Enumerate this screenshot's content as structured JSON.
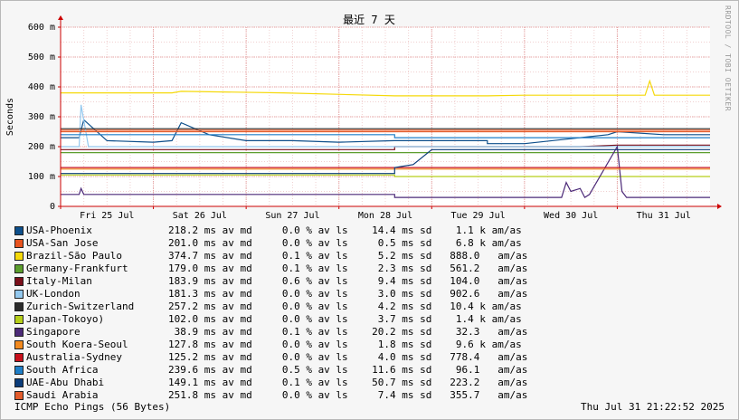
{
  "chart_data": {
    "type": "line",
    "title": "最近 7 天",
    "ylabel": "Seconds",
    "ylim": [
      0,
      0.6
    ],
    "y_ticks": [
      {
        "v": 0,
        "label": "0"
      },
      {
        "v": 0.1,
        "label": "100 m"
      },
      {
        "v": 0.2,
        "label": "200 m"
      },
      {
        "v": 0.3,
        "label": "300 m"
      },
      {
        "v": 0.4,
        "label": "400 m"
      },
      {
        "v": 0.5,
        "label": "500 m"
      },
      {
        "v": 0.6,
        "label": "600 m"
      }
    ],
    "x_range": [
      0,
      7
    ],
    "x_ticks": [
      {
        "v": 0.5,
        "label": "Fri 25 Jul"
      },
      {
        "v": 1.5,
        "label": "Sat 26 Jul"
      },
      {
        "v": 2.5,
        "label": "Sun 27 Jul"
      },
      {
        "v": 3.5,
        "label": "Mon 28 Jul"
      },
      {
        "v": 4.5,
        "label": "Tue 29 Jul"
      },
      {
        "v": 5.5,
        "label": "Wed 30 Jul"
      },
      {
        "v": 6.5,
        "label": "Thu 31 Jul"
      }
    ],
    "grid": true,
    "series": [
      {
        "name": "USA-Phoenix",
        "color": "#0d4f8b",
        "stats": "218.2 ms av md     0.0 % av ls    14.4 ms sd    1.1 k am/as",
        "x": [
          0,
          0.2,
          0.25,
          0.5,
          1.0,
          1.2,
          1.3,
          1.6,
          2.0,
          2.5,
          3.0,
          3.6,
          4.0,
          4.6,
          4.6,
          5.0,
          5.9,
          6.0,
          6.5,
          7.0
        ],
        "y": [
          0.23,
          0.23,
          0.29,
          0.22,
          0.215,
          0.22,
          0.28,
          0.24,
          0.22,
          0.22,
          0.215,
          0.22,
          0.22,
          0.22,
          0.21,
          0.21,
          0.24,
          0.25,
          0.24,
          0.24
        ]
      },
      {
        "name": "USA-San Jose",
        "color": "#e8541f",
        "stats": "201.0 ms av md     0.0 % av ls     0.5 ms sd    6.8 k am/as",
        "x": [
          0,
          7
        ],
        "y": [
          0.255,
          0.255
        ]
      },
      {
        "name": "Brazil-São Paulo",
        "color": "#f5d90a",
        "stats": "374.7 ms av md     0.1 % av ls     5.2 ms sd   888.0   am/as",
        "x": [
          0,
          1.2,
          1.3,
          2.4,
          3.6,
          4.6,
          5.0,
          6.3,
          6.35,
          6.4,
          7.0
        ],
        "y": [
          0.38,
          0.38,
          0.385,
          0.38,
          0.37,
          0.37,
          0.372,
          0.372,
          0.42,
          0.372,
          0.372
        ]
      },
      {
        "name": "Germany-Frankfurt",
        "color": "#5c9e2e",
        "stats": "179.0 ms av md     0.1 % av ls     2.3 ms sd   561.2   am/as",
        "x": [
          0,
          7
        ],
        "y": [
          0.18,
          0.18
        ]
      },
      {
        "name": "Italy-Milan",
        "color": "#7a0f1a",
        "stats": "183.9 ms av md     0.6 % av ls     9.4 ms sd   104.0   am/as",
        "x": [
          0,
          1.6,
          3.6,
          3.6,
          5.6,
          6.0,
          7.0
        ],
        "y": [
          0.19,
          0.19,
          0.19,
          0.2,
          0.2,
          0.205,
          0.205
        ]
      },
      {
        "name": "UK-London",
        "color": "#93c8ee",
        "stats": "181.3 ms av md     0.0 % av ls     3.0 ms sd   902.6   am/as",
        "x": [
          0,
          0.2,
          0.22,
          0.3,
          1.0,
          2.0,
          3.0,
          4.0,
          5.0,
          6.0,
          7.0
        ],
        "y": [
          0.2,
          0.2,
          0.34,
          0.2,
          0.2,
          0.2,
          0.2,
          0.2,
          0.2,
          0.2,
          0.2
        ]
      },
      {
        "name": "Zurich-Switzerland",
        "color": "#2b2b2b",
        "stats": "257.2 ms av md     0.0 % av ls     4.2 ms sd   10.4 k am/as",
        "x": [
          0,
          7
        ],
        "y": [
          0.26,
          0.26
        ]
      },
      {
        "name": "Japan-Tokoyo)",
        "color": "#b6cf1a",
        "stats": "102.0 ms av md     0.0 % av ls     3.7 ms sd    1.4 k am/as",
        "x": [
          0,
          3.6,
          3.6,
          7.0
        ],
        "y": [
          0.105,
          0.105,
          0.1,
          0.1
        ]
      },
      {
        "name": "Singapore",
        "color": "#4c2a78",
        "stats": " 38.9 ms av md     0.1 % av ls    20.2 ms sd    32.3   am/as",
        "x": [
          0,
          0.2,
          0.22,
          0.25,
          3.6,
          3.6,
          5.4,
          5.45,
          5.5,
          5.6,
          5.65,
          5.7,
          6.0,
          6.05,
          6.1,
          7.0
        ],
        "y": [
          0.04,
          0.04,
          0.06,
          0.04,
          0.04,
          0.03,
          0.03,
          0.08,
          0.05,
          0.06,
          0.03,
          0.04,
          0.2,
          0.05,
          0.03,
          0.03
        ]
      },
      {
        "name": "South Koera-Seoul",
        "color": "#f2891e",
        "stats": "127.8 ms av md     0.0 % av ls     1.8 ms sd    9.6 k am/as",
        "x": [
          0,
          7
        ],
        "y": [
          0.125,
          0.125
        ]
      },
      {
        "name": "Australia-Sydney",
        "color": "#c8101c",
        "stats": "125.2 ms av md     0.0 % av ls     4.0 ms sd   778.4   am/as",
        "x": [
          0,
          7
        ],
        "y": [
          0.13,
          0.13
        ]
      },
      {
        "name": "South Africa",
        "color": "#1f7fc8",
        "stats": "239.6 ms av md     0.5 % av ls    11.6 ms sd    96.1   am/as",
        "x": [
          0,
          3.6,
          3.6,
          4.7,
          7.0
        ],
        "y": [
          0.24,
          0.24,
          0.23,
          0.23,
          0.23
        ]
      },
      {
        "name": "UAE-Abu Dhabi",
        "color": "#0b3c7a",
        "stats": "149.1 ms av md     0.1 % av ls    50.7 ms sd   223.2   am/as",
        "x": [
          0,
          3.6,
          3.6,
          3.8,
          4.0,
          7.0
        ],
        "y": [
          0.11,
          0.11,
          0.13,
          0.14,
          0.19,
          0.19
        ]
      },
      {
        "name": "Saudi Arabia",
        "color": "#e35c2c",
        "stats": "251.8 ms av md     0.0 % av ls     7.4 ms sd   355.7   am/as",
        "x": [
          0,
          7
        ],
        "y": [
          0.25,
          0.25
        ]
      }
    ]
  },
  "footer": {
    "left": "ICMP Echo Pings (56 Bytes)",
    "right": "Thu Jul 31 21:22:52 2025"
  },
  "watermark": "RRDTOOL / TOBI OETIKER"
}
